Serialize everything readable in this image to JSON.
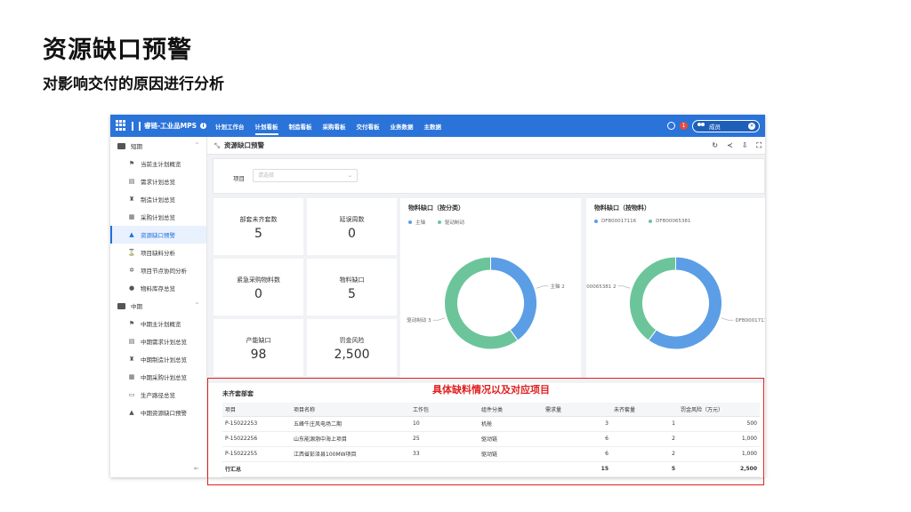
{
  "slide": {
    "title": "资源缺口预警",
    "subtitle": "对影响交付的原因进行分析",
    "annotation": "具体缺料情况以及对应项目"
  },
  "topbar": {
    "brand": "睿链-工业品MPS",
    "tabs": [
      "计划工作台",
      "计划看板",
      "制造看板",
      "采购看板",
      "交付看板",
      "业务数据",
      "主数据"
    ],
    "active_tab": 1,
    "badge": "1",
    "user": "成员"
  },
  "sidebar": {
    "groups": [
      {
        "label": "短期",
        "items": [
          "当前主计划概览",
          "需求计划总览",
          "制造计划总览",
          "采购计划总览",
          "资源缺口预警",
          "项目缺料分析",
          "项目节点协同分析",
          "物料库存总览"
        ]
      },
      {
        "label": "中期",
        "items": [
          "中期主计划概览",
          "中期需求计划总览",
          "中期制造计划总览",
          "中期采购计划总览",
          "生产路径总览",
          "中期资源缺口预警"
        ]
      }
    ],
    "active_item": "资源缺口预警"
  },
  "page": {
    "title": "资源缺口预警",
    "filter_label": "项目",
    "filter_placeholder": "请选择"
  },
  "kpis": [
    {
      "label": "部套未齐套数",
      "value": "5"
    },
    {
      "label": "延误周数",
      "value": "0"
    },
    {
      "label": "紧急采购物料数",
      "value": "0"
    },
    {
      "label": "物料缺口",
      "value": "5"
    },
    {
      "label": "产能缺口",
      "value": "98"
    },
    {
      "label": "罚金风险",
      "value": "2,500"
    }
  ],
  "chart_data": [
    {
      "type": "pie",
      "title": "物料缺口（按分类）",
      "categories": [
        "主轴",
        "驱动制动"
      ],
      "values": [
        2,
        3
      ],
      "slice_labels": [
        "主轴  2",
        "驱动制动  3"
      ],
      "colors": [
        "#5b9ee6",
        "#6cc59a"
      ],
      "legend": "top-left"
    },
    {
      "type": "pie",
      "title": "物料缺口（按物料）",
      "categories": [
        "DFB00017116",
        "DFB00065381"
      ],
      "values": [
        3,
        2
      ],
      "slice_labels": [
        "DFB00017116  3",
        "DFB00065381  2"
      ],
      "colors": [
        "#5b9ee6",
        "#6cc59a"
      ],
      "legend": "top-left"
    }
  ],
  "table": {
    "title": "未齐套部套",
    "headers": [
      "项目",
      "项目名称",
      "工作包",
      "组件分类",
      "需求量",
      "未齐套量",
      "罚金风险（万元）"
    ],
    "rows": [
      [
        "P-15022253",
        "五峰牛庄风电场二期",
        "10",
        "机舱",
        "3",
        "1",
        "500"
      ],
      [
        "P-15022256",
        "山东能源渤中海上项目",
        "25",
        "驱动链",
        "6",
        "2",
        "1,000"
      ],
      [
        "P-15022255",
        "江西省彭泽县100MW项目",
        "33",
        "驱动链",
        "6",
        "2",
        "1,000"
      ]
    ],
    "total": [
      "行汇总",
      "",
      "",
      "",
      "15",
      "5",
      "2,500"
    ]
  },
  "colors": {
    "topbar": "#2a73d9",
    "accent": "#1e6fe0",
    "series1": "#5b9ee6",
    "series2": "#6cc59a",
    "annotation": "#e02020"
  }
}
